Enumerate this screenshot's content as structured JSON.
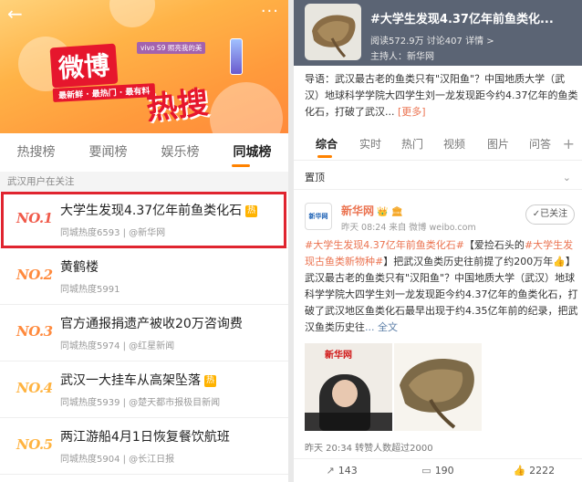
{
  "left": {
    "banner": {
      "sponsor_text": "vivo S9 照亮我的美",
      "logo_main": "微博",
      "logo_sub": "热搜",
      "slogan": "最新鲜 · 最热门 · 最有料"
    },
    "tabs": [
      {
        "label": "热搜榜"
      },
      {
        "label": "要闻榜"
      },
      {
        "label": "娱乐榜"
      },
      {
        "label": "同城榜"
      }
    ],
    "section_label": "武汉用户在关注",
    "rows": [
      {
        "rank": "NO.1",
        "title": "大学生发现4.37亿年前鱼类化石",
        "meta": "同城热度6593 | @新华网",
        "hot": "热"
      },
      {
        "rank": "NO.2",
        "title": "黄鹤楼",
        "meta": "同城热度5991",
        "hot": ""
      },
      {
        "rank": "NO.3",
        "title": "官方通报捐遗产被收20万咨询费",
        "meta": "同城热度5974 | @红星新闻",
        "hot": ""
      },
      {
        "rank": "NO.4",
        "title": "武汉一大挂车从高架坠落",
        "meta": "同城热度5939 | @楚天都市报极目新闻",
        "hot": "热"
      },
      {
        "rank": "NO.5",
        "title": "两江游船4月1日恢复餐饮航班",
        "meta": "同城热度5904 | @长江日报",
        "hot": ""
      }
    ]
  },
  "right": {
    "topic": {
      "title": "#大学生发现4.37亿年前鱼类化...",
      "stats": "阅读572.9万  讨论407  详情 >",
      "host": "主持人：新华网"
    },
    "guide": {
      "text": "导语：武汉最古老的鱼类只有\"汉阳鱼\"？中国地质大学（武汉）地球科学学院大四学生刘一龙发现距今约4.37亿年的鱼类化石，打破了武汉...",
      "more": "[更多]"
    },
    "tabs": [
      {
        "label": "综合"
      },
      {
        "label": "实时"
      },
      {
        "label": "热门"
      },
      {
        "label": "视频"
      },
      {
        "label": "图片"
      },
      {
        "label": "问答"
      }
    ],
    "tabs_plus": "+",
    "pinned_label": "置顶",
    "post": {
      "avatar_text": "新华网",
      "author": "新华网",
      "author_badge": "👑 🏛",
      "time": "昨天 08:24  来自 微博 weibo.com",
      "follow_label": "✓已关注",
      "tag1": "#大学生发现4.37亿年前鱼类化石#",
      "text1": "【爱捡石头的",
      "tag2": "#大学生发现古鱼类新物种#",
      "text2": "】把武汉鱼类历史往前提了约200万年👍】武汉最古老的鱼类只有\"汉阳鱼\"？中国地质大学（武汉）地球科学学院大四学生刘一龙发现距今约4.37亿年的鱼类化石，打破了武汉地区鱼类化石最早出现于约4.35亿年前的纪录，把武汉鱼类历史往",
      "more_link": "... 全文",
      "media_caption": "新华网",
      "likes_line": "昨天 20:34 转赞人数超过2000",
      "actions": [
        {
          "icon": "share-icon",
          "glyph": "↗",
          "count": "143"
        },
        {
          "icon": "comment-icon",
          "glyph": "▭",
          "count": "190"
        },
        {
          "icon": "like-icon",
          "glyph": "👍",
          "count": "2222"
        }
      ]
    }
  }
}
